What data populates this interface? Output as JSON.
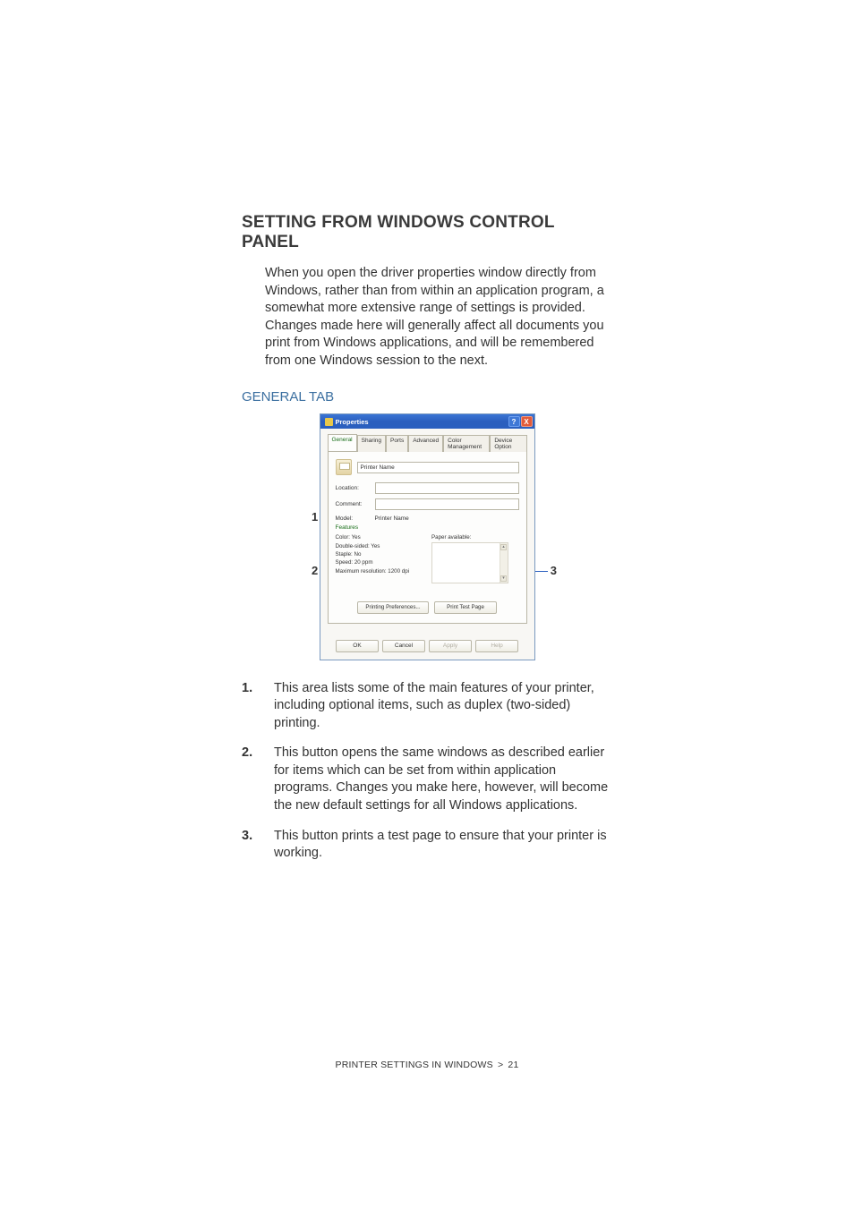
{
  "heading": "SETTING FROM WINDOWS CONTROL PANEL",
  "intro": "When you open the driver properties window directly from Windows, rather than from within an application program, a somewhat more extensive range of settings is provided. Changes made here will generally affect all documents you print from Windows applications, and will be remembered from one Windows session to the next.",
  "subsection": "GENERAL TAB",
  "dialog": {
    "titlebar": {
      "title": "Properties",
      "help": "?",
      "close": "X"
    },
    "tabs": [
      "General",
      "Sharing",
      "Ports",
      "Advanced",
      "Color Management",
      "Device Option"
    ],
    "printer_name": "Printer Name",
    "location_label": "Location:",
    "location_value": "",
    "comment_label": "Comment:",
    "comment_value": "",
    "model_label": "Model:",
    "model_value": "Printer Name",
    "features_heading": "Features",
    "features_left": [
      "Color: Yes",
      "Double-sided: Yes",
      "Staple: No",
      "Speed: 20 ppm",
      "Maximum resolution: 1200 dpi"
    ],
    "paper_avail_label": "Paper available:",
    "btn_prefs": "Printing Preferences...",
    "btn_testpage": "Print Test Page",
    "btn_ok": "OK",
    "btn_cancel": "Cancel",
    "btn_apply": "Apply",
    "btn_help": "Help"
  },
  "callouts": {
    "c1": "1",
    "c2": "2",
    "c3": "3"
  },
  "list": {
    "i1": {
      "num": "1.",
      "text": "This area lists some of the main features of your printer, including optional items, such as duplex (two-sided) printing."
    },
    "i2": {
      "num": "2.",
      "text": "This button opens the same windows as described earlier for items which can be set from within application programs. Changes you make here, however, will become the new default settings for all Windows applications."
    },
    "i3": {
      "num": "3.",
      "text": "This button prints a test page to ensure that your printer is working."
    }
  },
  "footer": {
    "text": "PRINTER SETTINGS IN WINDOWS",
    "sep": ">",
    "page": "21"
  }
}
